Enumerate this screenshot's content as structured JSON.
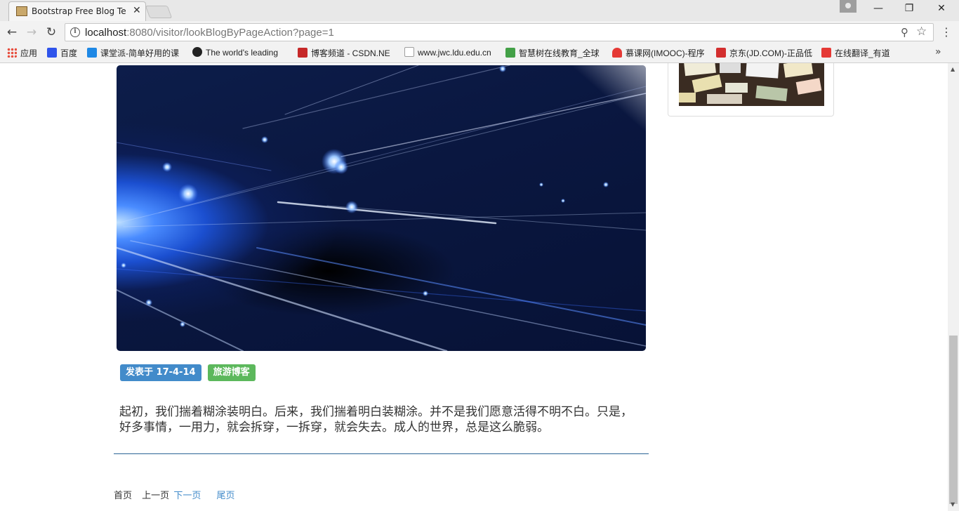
{
  "browser": {
    "tab_title": "Bootstrap Free Blog Te",
    "url_host": "localhost",
    "url_rest": ":8080/visitor/lookBlogByPageAction?page=1"
  },
  "bookmarks": [
    {
      "label": "应用",
      "color": "#e74c3c"
    },
    {
      "label": "百度",
      "color": "#2f54eb"
    },
    {
      "label": "课堂派-简单好用的课",
      "color": "#1e88e5"
    },
    {
      "label": "The world's leading",
      "color": "#222222"
    },
    {
      "label": "博客频道 - CSDN.NE",
      "color": "#c62828"
    },
    {
      "label": "www.jwc.ldu.edu.cn",
      "color": "#9e9e9e"
    },
    {
      "label": "智慧树在线教育_全球",
      "color": "#43a047"
    },
    {
      "label": "慕课网(IMOOC)-程序",
      "color": "#e53935"
    },
    {
      "label": "京东(JD.COM)-正品低",
      "color": "#d32f2f"
    },
    {
      "label": "在线翻译_有道",
      "color": "#e53935"
    }
  ],
  "post": {
    "date_badge": "发表于 17-4-14",
    "tag_badge": "旅游博客",
    "excerpt": "起初，我们揣着糊涂装明白。后来，我们揣着明白装糊涂。并不是我们愿意活得不明不白。只是，好多事情，一用力，就会拆穿，一拆穿，就会失去。成人的世界，总是这么脆弱。"
  },
  "pager": {
    "first": "首页",
    "prev": "上一页",
    "next": "下一页",
    "last": "尾页"
  },
  "colors": {
    "date_badge": "#428bca",
    "tag_badge": "#5cb85c",
    "link": "#428bca"
  }
}
